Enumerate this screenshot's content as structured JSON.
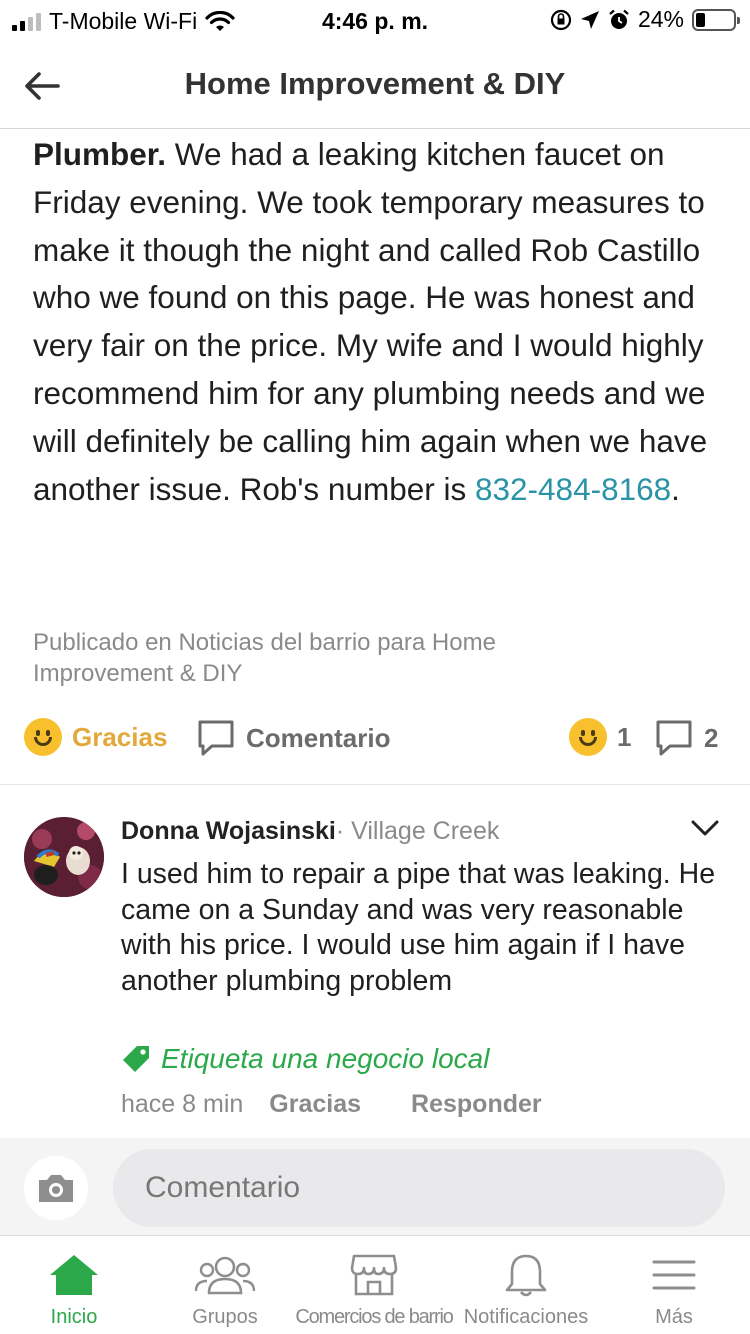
{
  "status_bar": {
    "carrier": "T-Mobile Wi-Fi",
    "time": "4:46 p. m.",
    "battery": "24%",
    "battery_level": 0.24
  },
  "header": {
    "title": "Home Improvement & DIY",
    "back_icon": "arrow-left-icon"
  },
  "post": {
    "bold_lead": "Plumber.",
    "body": " We had a leaking kitchen faucet on Friday evening.  We took temporary measures to make it though the night and called Rob Castillo who we found on this page.  He was honest and very fair on the price.  My wife and I would highly recommend him for any plumbing needs and we will definitely be calling him again when we have another issue.  Rob's number is ",
    "phone": "832-484-8168",
    "trailing": ".",
    "meta": "Publicado en Noticias del barrio para Home Improvement & DIY"
  },
  "actions": {
    "thanks_label": "Gracias",
    "comment_label": "Comentario",
    "thanks_count": "1",
    "comment_count": "2"
  },
  "comment": {
    "author": "Donna Wojasinski",
    "separator": "·",
    "location": " Village Creek",
    "text": "I used him to repair a pipe that was leaking. He came on a Sunday and was very reasonable with his price. I would use him again if I have another plumbing problem",
    "tag_label": "Etiqueta una negocio local",
    "time_ago": "hace 8 min",
    "thanks_label": "Gracias",
    "reply_label": "Responder"
  },
  "composer": {
    "placeholder": "Comentario"
  },
  "tabbar": {
    "tabs": [
      {
        "label": "Inicio",
        "icon": "home-icon",
        "active": true
      },
      {
        "label": "Grupos",
        "icon": "groups-icon"
      },
      {
        "label": "Comercios de barrio",
        "icon": "storefront-icon"
      },
      {
        "label": "Notificaciones",
        "icon": "bell-icon"
      },
      {
        "label": "Más",
        "icon": "menu-icon"
      }
    ]
  },
  "colors": {
    "accent_green": "#2aa84a",
    "link_teal": "#2a93a8",
    "thanks_gold": "#e3a83a",
    "smiley_yellow": "#f7c02c"
  }
}
